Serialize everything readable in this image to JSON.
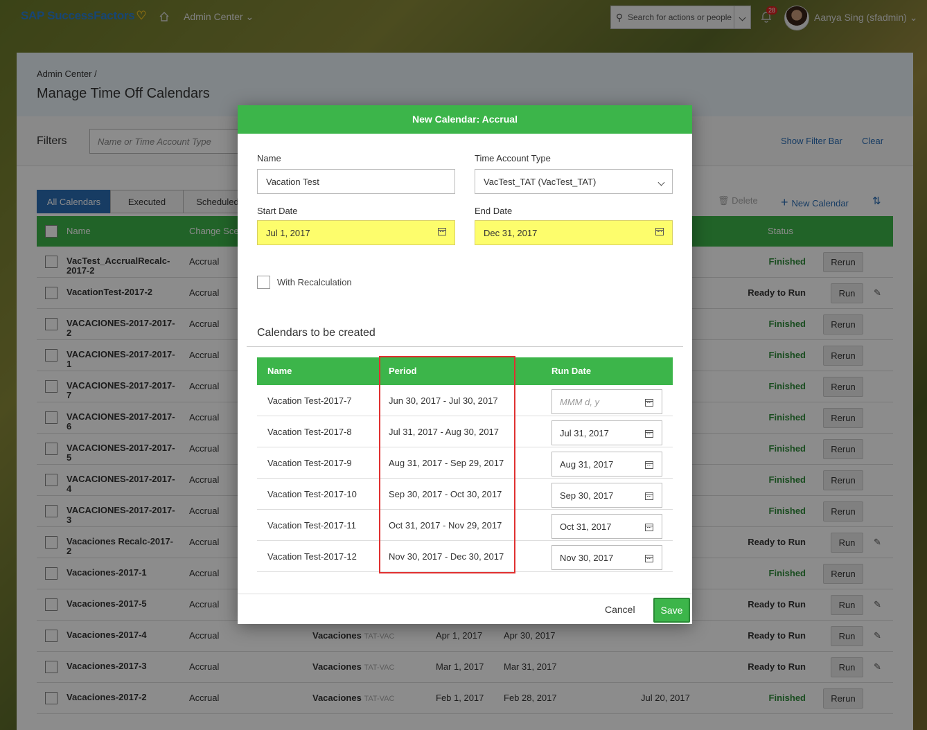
{
  "shell": {
    "logo": "SAP SuccessFactors",
    "nav_admin": "Admin Center ⌄",
    "search_placeholder": "Search for actions or people",
    "notification_count": "28",
    "user": "Aanya Sing (sfadmin) ⌄"
  },
  "page": {
    "breadcrumb": "Admin Center /",
    "title": "Manage Time Off Calendars",
    "filters_label": "Filters",
    "filter_placeholder": "Name or Time Account Type",
    "show_filter_bar": "Show Filter Bar",
    "clear": "Clear",
    "tabs": [
      "All Calendars",
      "Executed",
      "Scheduled"
    ],
    "toolbar": {
      "delete": "Delete",
      "new_calendar": "New Calendar"
    },
    "columns": {
      "name": "Name",
      "change_scenario": "Change Sce",
      "status": "Status"
    },
    "rows": [
      {
        "name": "VacTest_AccrualRecalc-2017-2",
        "type": "Accrual",
        "status": "Finished",
        "action": "Rerun"
      },
      {
        "name": "VacationTest-2017-2",
        "type": "Accrual",
        "status": "Ready to Run",
        "action": "Run"
      },
      {
        "name": "VACACIONES-2017-2017-2",
        "type": "Accrual",
        "status": "Finished",
        "action": "Rerun"
      },
      {
        "name": "VACACIONES-2017-2017-1",
        "type": "Accrual",
        "status": "Finished",
        "action": "Rerun"
      },
      {
        "name": "VACACIONES-2017-2017-7",
        "type": "Accrual",
        "status": "Finished",
        "action": "Rerun"
      },
      {
        "name": "VACACIONES-2017-2017-6",
        "type": "Accrual",
        "status": "Finished",
        "action": "Rerun"
      },
      {
        "name": "VACACIONES-2017-2017-5",
        "type": "Accrual",
        "status": "Finished",
        "action": "Rerun"
      },
      {
        "name": "VACACIONES-2017-2017-4",
        "type": "Accrual",
        "status": "Finished",
        "action": "Rerun"
      },
      {
        "name": "VACACIONES-2017-2017-3",
        "type": "Accrual",
        "status": "Finished",
        "action": "Rerun"
      },
      {
        "name": "Vacaciones Recalc-2017-2",
        "type": "Accrual",
        "status": "Ready to Run",
        "action": "Run"
      },
      {
        "name": "Vacaciones-2017-1",
        "type": "Accrual",
        "status": "Finished",
        "action": "Rerun"
      },
      {
        "name": "Vacaciones-2017-5",
        "type": "Accrual",
        "status": "Ready to Run",
        "action": "Run"
      },
      {
        "name": "Vacaciones-2017-4",
        "type": "Accrual",
        "account": "Vacaciones",
        "account_code": "TAT-VAC",
        "start": "Apr 1, 2017",
        "end": "Apr 30, 2017",
        "status": "Ready to Run",
        "action": "Run"
      },
      {
        "name": "Vacaciones-2017-3",
        "type": "Accrual",
        "account": "Vacaciones",
        "account_code": "TAT-VAC",
        "start": "Mar 1, 2017",
        "end": "Mar 31, 2017",
        "status": "Ready to Run",
        "action": "Run"
      },
      {
        "name": "Vacaciones-2017-2",
        "type": "Accrual",
        "account": "Vacaciones",
        "account_code": "TAT-VAC",
        "start": "Feb 1, 2017",
        "end": "Feb 28, 2017",
        "run_date": "Jul 20, 2017",
        "status": "Finished",
        "action": "Rerun"
      }
    ]
  },
  "dialog": {
    "title": "New Calendar: Accrual",
    "name_label": "Name",
    "name_value": "Vacation Test",
    "tat_label": "Time Account Type",
    "tat_value": "VacTest_TAT (VacTest_TAT)",
    "start_label": "Start Date",
    "start_value": "Jul 1, 2017",
    "end_label": "End Date",
    "end_value": "Dec 31, 2017",
    "recalc_label": "With Recalculation",
    "section_title": "Calendars to be created",
    "table_headers": {
      "name": "Name",
      "period": "Period",
      "run_date": "Run Date"
    },
    "run_date_placeholder": "MMM d, y",
    "calendars": [
      {
        "name": "Vacation Test-2017-7",
        "period": "Jun 30, 2017 - Jul 30, 2017",
        "run_date": ""
      },
      {
        "name": "Vacation Test-2017-8",
        "period": "Jul 31, 2017 - Aug 30, 2017",
        "run_date": "Jul 31, 2017"
      },
      {
        "name": "Vacation Test-2017-9",
        "period": "Aug 31, 2017 - Sep 29, 2017",
        "run_date": "Aug 31, 2017"
      },
      {
        "name": "Vacation Test-2017-10",
        "period": "Sep 30, 2017 - Oct 30, 2017",
        "run_date": "Sep 30, 2017"
      },
      {
        "name": "Vacation Test-2017-11",
        "period": "Oct 31, 2017 - Nov 29, 2017",
        "run_date": "Oct 31, 2017"
      },
      {
        "name": "Vacation Test-2017-12",
        "period": "Nov 30, 2017 - Dec 30, 2017",
        "run_date": "Nov 30, 2017"
      }
    ],
    "cancel": "Cancel",
    "save": "Save"
  }
}
